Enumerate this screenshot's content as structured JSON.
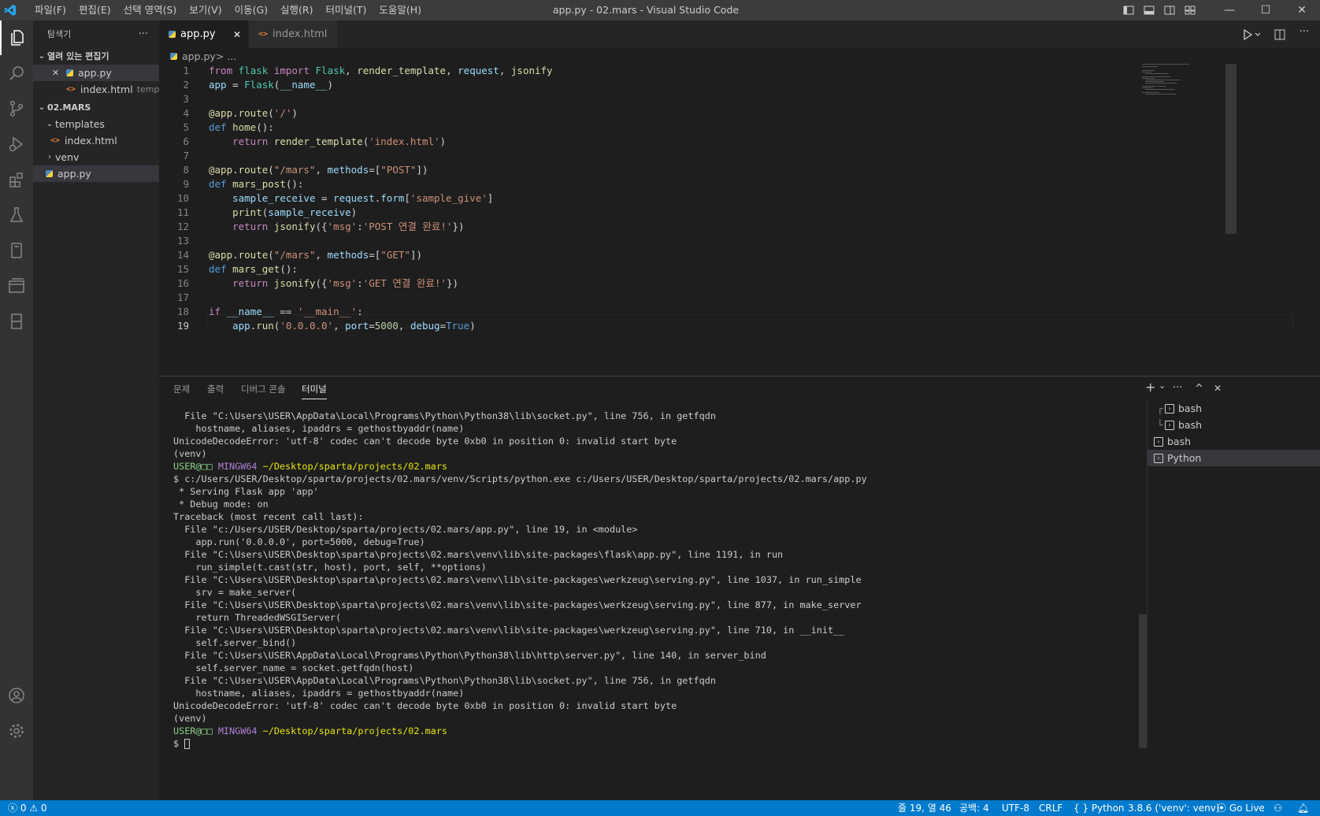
{
  "window": {
    "title": "app.py - 02.mars - Visual Studio Code",
    "menu": [
      "파일(F)",
      "편집(E)",
      "선택 영역(S)",
      "보기(V)",
      "이동(G)",
      "실행(R)",
      "터미널(T)",
      "도움말(H)"
    ],
    "controls": {
      "minimize": "—",
      "maximize": "☐",
      "close": "✕"
    }
  },
  "sidebar": {
    "title": "탐색기",
    "more": "···",
    "open_editors": {
      "label": "열려 있는 편집기",
      "items": [
        {
          "name": "app.py",
          "close": "✕"
        },
        {
          "name": "index.html",
          "hint": "templ..."
        }
      ]
    },
    "workspace": {
      "label": "02.MARS",
      "items": [
        {
          "name": "templates"
        },
        {
          "name": "index.html"
        },
        {
          "name": "venv"
        },
        {
          "name": "app.py"
        }
      ]
    }
  },
  "tabs": [
    {
      "label": "app.py",
      "close": "✕"
    },
    {
      "label": "index.html"
    }
  ],
  "breadcrumb": {
    "file": "app.py",
    "rest": " > ..."
  },
  "editor": {
    "line_numbers": [
      "1",
      "2",
      "3",
      "4",
      "5",
      "6",
      "7",
      "8",
      "9",
      "10",
      "11",
      "12",
      "13",
      "14",
      "15",
      "16",
      "17",
      "18",
      "19"
    ]
  },
  "panel": {
    "tabs": [
      "문제",
      "출력",
      "디버그 콘솔",
      "터미널"
    ],
    "actions": {
      "add": "+",
      "dropdown": "⌄",
      "more": "···",
      "maximize": "^",
      "close": "✕"
    },
    "terminal_lines": [
      "  File \"C:\\Users\\USER\\AppData\\Local\\Programs\\Python\\Python38\\lib\\socket.py\", line 756, in getfqdn",
      "    hostname, aliases, ipaddrs = gethostbyaddr(name)",
      "UnicodeDecodeError: 'utf-8' codec can't decode byte 0xb0 in position 0: invalid start byte",
      "(venv)",
      "PROMPT1",
      "$ c:/Users/USER/Desktop/sparta/projects/02.mars/venv/Scripts/python.exe c:/Users/USER/Desktop/sparta/projects/02.mars/app.py",
      " * Serving Flask app 'app'",
      " * Debug mode: on",
      "Traceback (most recent call last):",
      "  File \"c:/Users/USER/Desktop/sparta/projects/02.mars/app.py\", line 19, in <module>",
      "    app.run('0.0.0.0', port=5000, debug=True)",
      "  File \"C:\\Users\\USER\\Desktop\\sparta\\projects\\02.mars\\venv\\lib\\site-packages\\flask\\app.py\", line 1191, in run",
      "    run_simple(t.cast(str, host), port, self, **options)",
      "  File \"C:\\Users\\USER\\Desktop\\sparta\\projects\\02.mars\\venv\\lib\\site-packages\\werkzeug\\serving.py\", line 1037, in run_simple",
      "    srv = make_server(",
      "  File \"C:\\Users\\USER\\Desktop\\sparta\\projects\\02.mars\\venv\\lib\\site-packages\\werkzeug\\serving.py\", line 877, in make_server",
      "    return ThreadedWSGIServer(",
      "  File \"C:\\Users\\USER\\Desktop\\sparta\\projects\\02.mars\\venv\\lib\\site-packages\\werkzeug\\serving.py\", line 710, in __init__",
      "    self.server_bind()",
      "  File \"C:\\Users\\USER\\AppData\\Local\\Programs\\Python\\Python38\\lib\\http\\server.py\", line 140, in server_bind",
      "    self.server_name = socket.getfqdn(host)",
      "  File \"C:\\Users\\USER\\AppData\\Local\\Programs\\Python\\Python38\\lib\\socket.py\", line 756, in getfqdn",
      "    hostname, aliases, ipaddrs = gethostbyaddr(name)",
      "UnicodeDecodeError: 'utf-8' codec can't decode byte 0xb0 in position 0: invalid start byte",
      "(venv)",
      "PROMPT2",
      "$ "
    ],
    "prompt": {
      "user": "USER@□□",
      "host": "MINGW64",
      "path": "~/Desktop/sparta/projects/02.mars"
    },
    "terminal_list": [
      "bash",
      "bash",
      "bash",
      "Python"
    ]
  },
  "status": {
    "errors": "0",
    "warnings": "0",
    "position": "줄 19, 열 46",
    "spaces": "공백: 4",
    "encoding": "UTF-8",
    "eol": "CRLF",
    "language": "Python",
    "interpreter": "3.8.6 ('venv': venv)",
    "golive": "Go Live"
  },
  "colors": {
    "accent": "#007acc",
    "titlebar": "#3c3c3c",
    "activitybar": "#333333",
    "sidebar": "#252526",
    "editor": "#1e1e1e"
  }
}
